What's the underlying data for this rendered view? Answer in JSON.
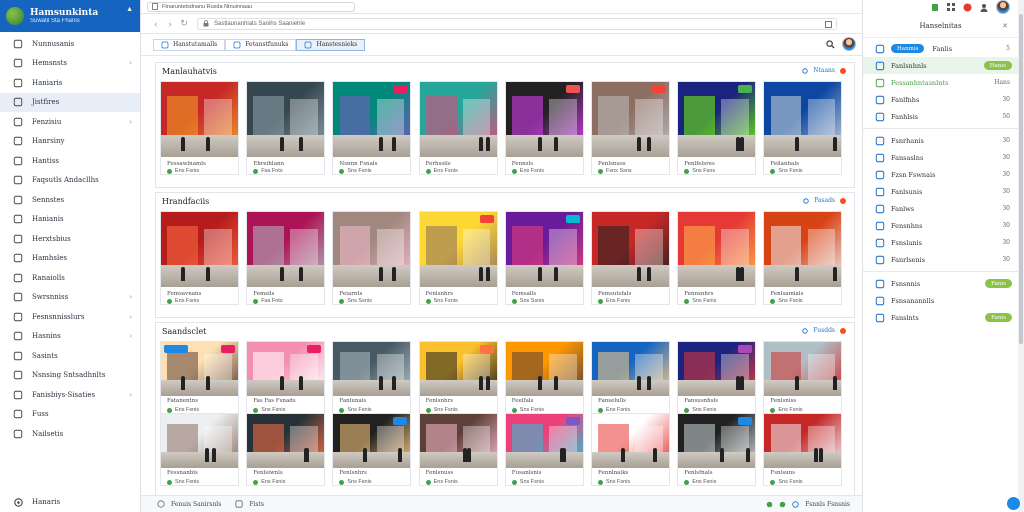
{
  "sidebar": {
    "brand_title": "Hamsunkinta",
    "brand_subtitle": "Suwatil Sta Fhanis",
    "items": [
      {
        "label": "Nunnusanis",
        "icon": "home-icon",
        "chevron": false
      },
      {
        "label": "Hemsnsts",
        "icon": "tag-icon",
        "chevron": true
      },
      {
        "label": "Haniaris",
        "icon": "shield-icon",
        "chevron": false
      },
      {
        "label": "Jistfires",
        "icon": "document-icon",
        "chevron": false,
        "active": true
      },
      {
        "label": "Fenzisiu",
        "icon": "clock-icon",
        "chevron": true
      },
      {
        "label": "Hanrsiny",
        "icon": "calendar-icon",
        "chevron": false
      },
      {
        "label": "Hantiss",
        "icon": "phone-icon",
        "chevron": false
      },
      {
        "label": "Faqsutls Andacllhs",
        "icon": "download-icon",
        "chevron": false
      },
      {
        "label": "Sennstes",
        "icon": "grid-icon",
        "chevron": false
      },
      {
        "label": "Hanianis",
        "icon": "card-icon",
        "chevron": false
      },
      {
        "label": "Herxtsbius",
        "icon": "list-icon",
        "chevron": false
      },
      {
        "label": "Hamhsles",
        "icon": "sliders-icon",
        "chevron": false
      },
      {
        "label": "Ranaiolls",
        "icon": "chat-icon",
        "chevron": false
      },
      {
        "label": "Swrsnniss",
        "icon": "box-icon",
        "chevron": true
      },
      {
        "label": "Fesnsnnisslurs",
        "icon": "layers-icon",
        "chevron": true
      },
      {
        "label": "Hasnins",
        "icon": "user-icon",
        "chevron": true
      },
      {
        "label": "Sasints",
        "icon": "image-icon",
        "chevron": false
      },
      {
        "label": "Nsnsing Sntsadhnlts",
        "icon": "target-icon",
        "chevron": false
      },
      {
        "label": "Fanisbiys-Sisaties",
        "icon": "settings-icon",
        "chevron": true
      },
      {
        "label": "Fuss",
        "icon": "star-icon",
        "chevron": false
      },
      {
        "label": "Nailsetis",
        "icon": "mail-icon",
        "chevron": false
      }
    ],
    "bottom_label": "Hanaris"
  },
  "browser": {
    "url_text": "Ftnaruntetsdnanu Ruxda Ntnuinnaau",
    "address_text": "Sastlaunanhiats Sanihs Saaniehle"
  },
  "tabs": [
    {
      "label": "Hanstutamalls",
      "sel": false
    },
    {
      "label": "Fetanstfunuks",
      "sel": false
    },
    {
      "label": "Hanstesnieks",
      "sel": true
    }
  ],
  "sections": [
    {
      "title": "Manlauhatvis",
      "action": "Ntaans",
      "cards": [
        {
          "caption": "Fessawlnamls",
          "meta": "Ens Fsnis",
          "palette": [
            "#c62828",
            "#f5a623"
          ],
          "badge": null
        },
        {
          "caption": "Ehreihlann",
          "meta": "Fsa Fnts",
          "palette": [
            "#37474f",
            "#90a4ae"
          ],
          "badge": null
        },
        {
          "caption": "Nsnnn Fsnals",
          "meta": "Sns Fsnis",
          "palette": [
            "#00897b",
            "#7e57c2"
          ],
          "badge": "#e91e63"
        },
        {
          "caption": "Ferhssils",
          "meta": "Ens Fsnis",
          "palette": [
            "#26a69a",
            "#ec407a"
          ],
          "badge": null
        },
        {
          "caption": "Fennsls",
          "meta": "Ens Fsnis",
          "palette": [
            "#212121",
            "#e040fb"
          ],
          "badge": "#ef5350"
        },
        {
          "caption": "Fenlsnuss",
          "meta": "Fsns Ssns",
          "palette": [
            "#8d6e63",
            "#bdbdbd"
          ],
          "badge": "#f44336"
        },
        {
          "caption": "Fenlfelsres",
          "meta": "Sns Fsns",
          "palette": [
            "#1a237e",
            "#76ff03"
          ],
          "badge": "#4caf50"
        },
        {
          "caption": "Feilanhals",
          "meta": "Sns Fsnis",
          "palette": [
            "#0d47a1",
            "#cfd8dc"
          ],
          "badge": null
        }
      ]
    },
    {
      "title": "Hrandfaciis",
      "action": "Pasads",
      "cards": [
        {
          "caption": "Femsavnans",
          "meta": "Ens Fsnis",
          "palette": [
            "#b71c1c",
            "#ff7043"
          ],
          "badge": null
        },
        {
          "caption": "Femsils",
          "meta": "Fsa Fnts",
          "palette": [
            "#ad1457",
            "#b0bec5"
          ],
          "badge": null
        },
        {
          "caption": "Feiarnts",
          "meta": "Sns Ssnis",
          "palette": [
            "#a1887f",
            "#f8bbd0"
          ],
          "badge": null
        },
        {
          "caption": "Fenlsnhrs",
          "meta": "Sns Fsnis",
          "palette": [
            "#fdd835",
            "#8d6e63"
          ],
          "badge": "#f44336"
        },
        {
          "caption": "Femsalls",
          "meta": "Sns Ssnis",
          "palette": [
            "#6a1b9a",
            "#ec407a"
          ],
          "badge": "#00bcd4"
        },
        {
          "caption": "Femsutsfals",
          "meta": "Ens Fsnis",
          "palette": [
            "#c62828",
            "#212121"
          ],
          "badge": null
        },
        {
          "caption": "Fennsnhrs",
          "meta": "Sns Fsnis",
          "palette": [
            "#e53935",
            "#ffb74d"
          ],
          "badge": null
        },
        {
          "caption": "Fenlsamials",
          "meta": "Sns Fsnis",
          "palette": [
            "#d84315",
            "#eceff1"
          ],
          "badge": null
        }
      ]
    },
    {
      "title": "Saandsclet",
      "action": "Fusdds",
      "cards": [
        {
          "caption": "Fatanentns",
          "meta": "Ens Fsnis",
          "palette": [
            "#ffe0b2",
            "#5d4037"
          ],
          "badge": "#e91e63",
          "label": true
        },
        {
          "caption": "Fas Fas Fsnads",
          "meta": "Sns Fsnis",
          "palette": [
            "#f48fb1",
            "#ffffff"
          ],
          "badge": "#e91e63"
        },
        {
          "caption": "Fanlunais",
          "meta": "Sns Fsnis",
          "palette": [
            "#455a64",
            "#b0bec5"
          ],
          "badge": null
        },
        {
          "caption": "Fenlsnhrs",
          "meta": "Sns Fsnis",
          "palette": [
            "#fbc02d",
            "#212121"
          ],
          "badge": "#ff7043"
        },
        {
          "caption": "Feelfals",
          "meta": "Sns Fsnis",
          "palette": [
            "#ff9800",
            "#5d4037"
          ],
          "badge": null
        },
        {
          "caption": "Fanselulls",
          "meta": "Ens Fsnis",
          "palette": [
            "#1565c0",
            "#ffcc80"
          ],
          "badge": null
        },
        {
          "caption": "Fansusnhsls",
          "meta": "Sns Fsnis",
          "palette": [
            "#1a237e",
            "#e53935"
          ],
          "badge": "#ab47bc"
        },
        {
          "caption": "Fenlsniss",
          "meta": "Ens Fsnis",
          "palette": [
            "#b0bec5",
            "#d32f2f"
          ],
          "badge": null
        },
        {
          "caption": "Fessnanbls",
          "meta": "Sns Fsnis",
          "palette": [
            "#eceff1",
            "#8d6e63"
          ],
          "badge": null
        },
        {
          "caption": "Fenlsiwnls",
          "meta": "Ens Fsnis",
          "palette": [
            "#263238",
            "#ff7043"
          ],
          "badge": null
        },
        {
          "caption": "Fenlsnhrs",
          "meta": "Sns Fsnis",
          "palette": [
            "#212121",
            "#ffcc80"
          ],
          "badge": "#1e88e5"
        },
        {
          "caption": "Fenlsnuss",
          "meta": "Ens Fsnis",
          "palette": [
            "#5d4037",
            "#f8bbd0"
          ],
          "badge": null
        },
        {
          "caption": "Fusanlsnis",
          "meta": "Sns Fsnis",
          "palette": [
            "#ec407a",
            "#26c6da"
          ],
          "badge": "#7e57c2"
        },
        {
          "caption": "Fennlnaiks",
          "meta": "Sns Fsnis",
          "palette": [
            "#ffffff",
            "#e53935"
          ],
          "badge": null
        },
        {
          "caption": "Fenlsfnals",
          "meta": "Ens Fsnis",
          "palette": [
            "#212121",
            "#cfd8dc"
          ],
          "badge": "#1e88e5"
        },
        {
          "caption": "Fsnlsuns",
          "meta": "Sns Fsnis",
          "palette": [
            "#c62828",
            "#eceff1"
          ],
          "badge": null
        }
      ]
    }
  ],
  "status": {
    "left1": "Fenuis Sanirsnls",
    "left2": "Fists",
    "right": "Fsnnls Fsnsnis"
  },
  "rpanel": {
    "title": "Hanselnitas",
    "items": [
      {
        "label": "Fanlis",
        "icon": "cart-icon",
        "count": "5",
        "pill": "Hanmis",
        "pill_blue": true
      },
      {
        "label": "Fanlsnhnls",
        "icon": "info-icon",
        "count": "",
        "pill": "Hanis",
        "hl": true
      },
      {
        "label": "Fessanhntasnlnts",
        "icon": "play-icon",
        "count": "Hans",
        "green": true
      },
      {
        "label": "Fanlfnhs",
        "icon": "doc-icon",
        "count": "30"
      },
      {
        "label": "Fanhlsis",
        "icon": "check-icon",
        "count": "50"
      },
      {
        "sep": true
      },
      {
        "label": "Fsnrhanis",
        "icon": "list-icon",
        "count": "30"
      },
      {
        "label": "Fansaslns",
        "icon": "flag-icon",
        "count": "30"
      },
      {
        "label": "Fzsn Fswnais",
        "icon": "box-icon",
        "count": "30"
      },
      {
        "label": "Fanlsunis",
        "icon": "bell-icon",
        "count": "30"
      },
      {
        "label": "Fanlws",
        "icon": "file-icon",
        "count": "30"
      },
      {
        "label": "Fensnhns",
        "icon": "mail-icon",
        "count": "30"
      },
      {
        "label": "Fsnslanis",
        "icon": "layers-icon",
        "count": "30"
      },
      {
        "label": "Fanrlsenis",
        "icon": "calendar-icon",
        "count": "30"
      },
      {
        "sep": true
      },
      {
        "label": "Fsnsnnis",
        "icon": "globe-icon",
        "count": "",
        "pill": "Fanis"
      },
      {
        "label": "Fsnsanannlls",
        "icon": "clock-icon",
        "count": ""
      },
      {
        "label": "Fanslnts",
        "icon": "chat-icon",
        "count": "",
        "pill": "Fanis"
      }
    ]
  },
  "colors": {
    "brand": "#1565c0",
    "accent": "#1e88e5",
    "success": "#8bc34a"
  }
}
